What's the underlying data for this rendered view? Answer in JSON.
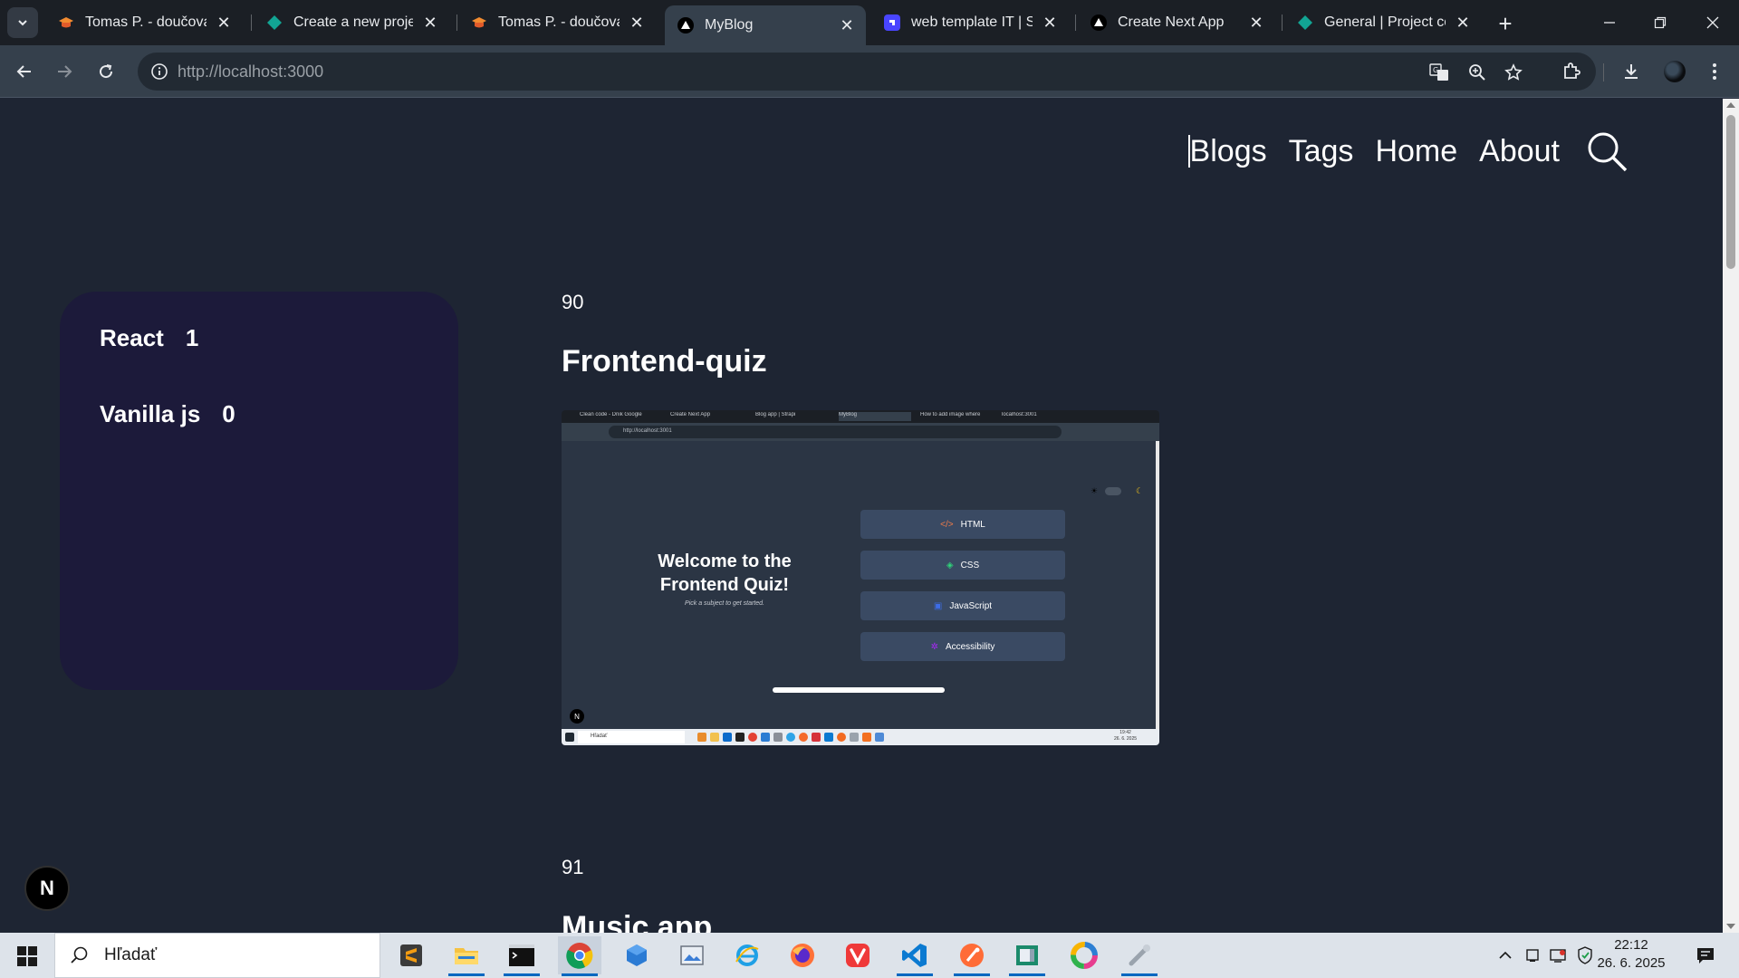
{
  "browser": {
    "tabs": [
      {
        "title": "Tomas P. - doučovanie",
        "favicon": "graduation-cap-icon"
      },
      {
        "title": "Create a new project",
        "favicon": "diamond-icon"
      },
      {
        "title": "Tomas P. - doučovanie",
        "favicon": "graduation-cap-icon"
      },
      {
        "title": "MyBlog",
        "favicon": "vercel-triangle-icon"
      },
      {
        "title": "web template IT | Strapi",
        "favicon": "strapi-icon"
      },
      {
        "title": "Create Next App",
        "favicon": "vercel-triangle-icon"
      },
      {
        "title": "General | Project conf",
        "favicon": "diamond-icon"
      }
    ],
    "active_tab": 3,
    "url_host": "http://localhost",
    "url_port": ":3000"
  },
  "site": {
    "nav": {
      "blogs": "Blogs",
      "tags": "Tags",
      "home": "Home",
      "about": "About"
    },
    "tags": [
      {
        "name": "React",
        "count": "1"
      },
      {
        "name": "Vanilla js",
        "count": "0"
      }
    ],
    "posts": [
      {
        "id": "90",
        "title": "Frontend-quiz"
      },
      {
        "id": "91",
        "title": "Music app"
      }
    ],
    "thumbnail": {
      "tabs": [
        "Clean code - Dnik Google",
        "Create Next App",
        "Blog app | Strapi",
        "MyBlog",
        "How to add image where",
        "localhost:3001"
      ],
      "url": "http://localhost:3001",
      "welcome_line1": "Welcome to the",
      "welcome_line2": "Frontend Quiz!",
      "subtitle": "Pick a subject to get started.",
      "subjects": [
        "HTML",
        "CSS",
        "JavaScript",
        "Accessibility"
      ],
      "taskbar_search": "Hľadať",
      "taskbar_time": "19:42",
      "taskbar_date": "26. 6. 2025"
    },
    "next_badge": "N"
  },
  "taskbar": {
    "search_placeholder": "Hľadať",
    "time": "22:12",
    "date": "26. 6. 2025"
  },
  "colors": {
    "page_bg": "#1e2533",
    "tags_card_bg": "#1c1a3a",
    "chrome_tab_active": "#35404c",
    "quiz_button": "#3a4a63"
  }
}
